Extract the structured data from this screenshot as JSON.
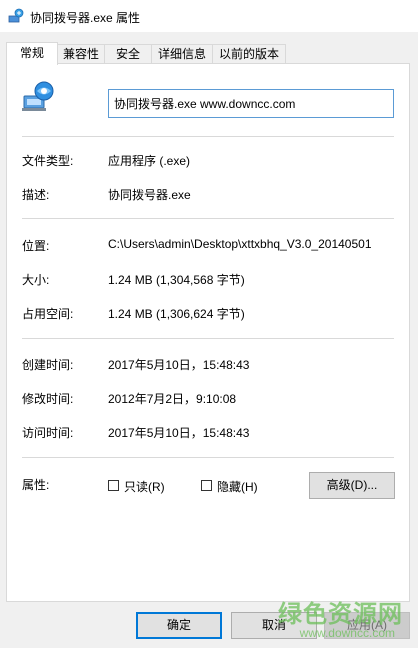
{
  "window": {
    "title": "协同拨号器.exe 属性"
  },
  "tabs": [
    {
      "label": "常规",
      "active": true
    },
    {
      "label": "兼容性",
      "active": false
    },
    {
      "label": "安全",
      "active": false
    },
    {
      "label": "详细信息",
      "active": false
    },
    {
      "label": "以前的版本",
      "active": false
    }
  ],
  "general": {
    "file_name": "协同拨号器.exe www.downcc.com",
    "type_label": "文件类型:",
    "type_value": "应用程序 (.exe)",
    "desc_label": "描述:",
    "desc_value": "协同拨号器.exe",
    "location_label": "位置:",
    "location_value": "C:\\Users\\admin\\Desktop\\xttxbhq_V3.0_20140501",
    "size_label": "大小:",
    "size_value": "1.24 MB (1,304,568 字节)",
    "disk_size_label": "占用空间:",
    "disk_size_value": "1.24 MB (1,306,624 字节)",
    "created_label": "创建时间:",
    "created_value": "2017年5月10日，15:48:43",
    "modified_label": "修改时间:",
    "modified_value": "2012年7月2日，9:10:08",
    "accessed_label": "访问时间:",
    "accessed_value": "2017年5月10日，15:48:43",
    "attributes_label": "属性:",
    "readonly_label": "只读(R)",
    "readonly_checked": false,
    "hidden_label": "隐藏(H)",
    "hidden_checked": false,
    "advanced_label": "高级(D)..."
  },
  "footer": {
    "ok_label": "确定",
    "cancel_label": "取消",
    "apply_label": "应用(A)"
  },
  "watermark": {
    "main": "绿色资源网",
    "sub": "www.downcc.com",
    "color": "#6cbf5a"
  }
}
